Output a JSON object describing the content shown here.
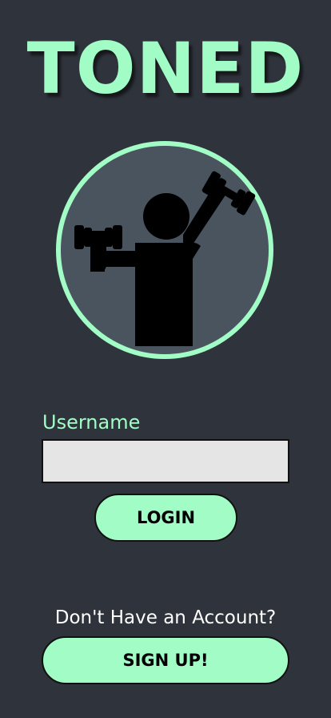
{
  "app": {
    "title": "TONED"
  },
  "logo": {
    "icon": "weightlifter-icon",
    "ring_color": "#a1fcc6",
    "fill_color": "#4a545e",
    "figure_color": "#000000"
  },
  "login_form": {
    "username_label": "Username",
    "username_value": "",
    "username_placeholder": "",
    "login_label": "LOGIN"
  },
  "signup": {
    "prompt": "Don't Have an Account?",
    "button_label": "SIGN UP!"
  },
  "colors": {
    "background": "#2f333b",
    "accent": "#a1fcc6",
    "input_bg": "#e5e5e5"
  }
}
